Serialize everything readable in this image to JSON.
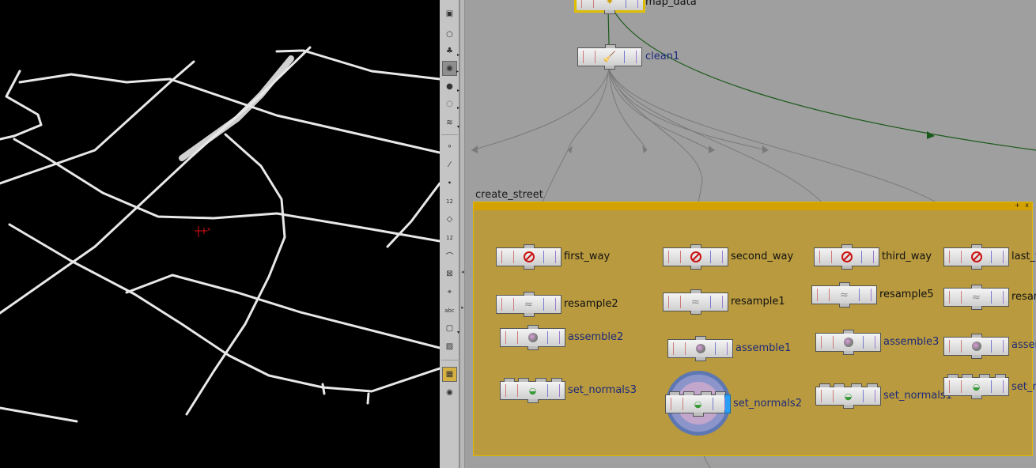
{
  "network": {
    "top_node": "map_data",
    "clean_node": "clean1",
    "netbox": {
      "title": "create_street",
      "buttons": "+ x"
    },
    "columns": [
      {
        "filter": "first_way",
        "resample": "resample2",
        "assemble": "assemble2",
        "normals": "set_normals3"
      },
      {
        "filter": "second_way",
        "resample": "resample1",
        "assemble": "assemble1",
        "normals": "set_normals2"
      },
      {
        "filter": "third_way",
        "resample": "resample5",
        "assemble": "assemble3",
        "normals": "set_normals1"
      },
      {
        "filter": "last_way",
        "resample": "resample",
        "assemble": "assemble",
        "normals": "set_normals"
      }
    ]
  },
  "viewport": {
    "axis_marker_label": "x",
    "background": "#000000",
    "road_color": "#e8e8e8"
  },
  "toolbar": {
    "tools": [
      "view-tool-icon",
      "sphere-icon",
      "light-icon",
      "display-options-icon",
      "shading-icon",
      "snapping-icon",
      "visibility-icon",
      "point-icon",
      "edge-icon",
      "vertex-icon",
      "point-numbers-icon",
      "primitive-icon",
      "primitive-numbers-icon",
      "normals-icon",
      "bounding-box-icon",
      "camera-icon",
      "text-icon",
      "annotation-icon",
      "background-image-icon",
      "grid-layout-icon",
      "eye-icon"
    ],
    "tool_glyphs": [
      "▣",
      "○",
      "♣",
      "◉",
      "●",
      "◌",
      "≋",
      "∘",
      "⁄",
      "∙",
      "∘",
      "◇",
      "◇",
      "⌒",
      "⊠",
      "⌖",
      "▭",
      "▢",
      "▨",
      "▦",
      "◉"
    ],
    "point_numbers_label": "12",
    "primitive_numbers_label": "12",
    "text_tool_label": "abc"
  },
  "colors": {
    "netbox_fill": "#b99a3e",
    "netbox_bar": "#d4a200",
    "wire": "#777777",
    "selected_wire": "#1a5a1a",
    "node_label": "#1d2a7a"
  }
}
